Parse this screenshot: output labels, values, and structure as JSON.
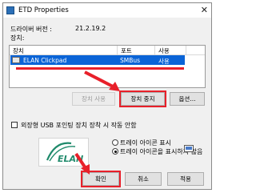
{
  "window": {
    "title": "ETD Properties",
    "close_glyph": "✕"
  },
  "info": {
    "driver_version_label": "드라이버 버전 :",
    "driver_version_value": "21.2.19.2",
    "devices_label": "장치:"
  },
  "device_list": {
    "columns": [
      "장치",
      "포트",
      "사용"
    ],
    "rows": [
      {
        "name": "ELAN Clickpad",
        "port": "SMBus",
        "status": "사용"
      }
    ]
  },
  "buttons": {
    "enable": "장치 사용",
    "stop": "장치 중지",
    "options": "옵션...",
    "ok": "확인",
    "cancel": "취소",
    "apply": "적용"
  },
  "checkbox": {
    "label": "외장형 USB 포인팅 장치 장착 시 작동 안함",
    "checked": false
  },
  "logo": {
    "text": "ELAN"
  },
  "tray": {
    "options": [
      {
        "label": "트레이 아이콘 표시",
        "selected": false
      },
      {
        "label": "트레이 아이콘을 표시하지 않음",
        "selected": true
      }
    ]
  },
  "colors": {
    "highlight": "#e8202a",
    "selection": "#0a64d7",
    "logo_green": "#1f8a6b"
  }
}
